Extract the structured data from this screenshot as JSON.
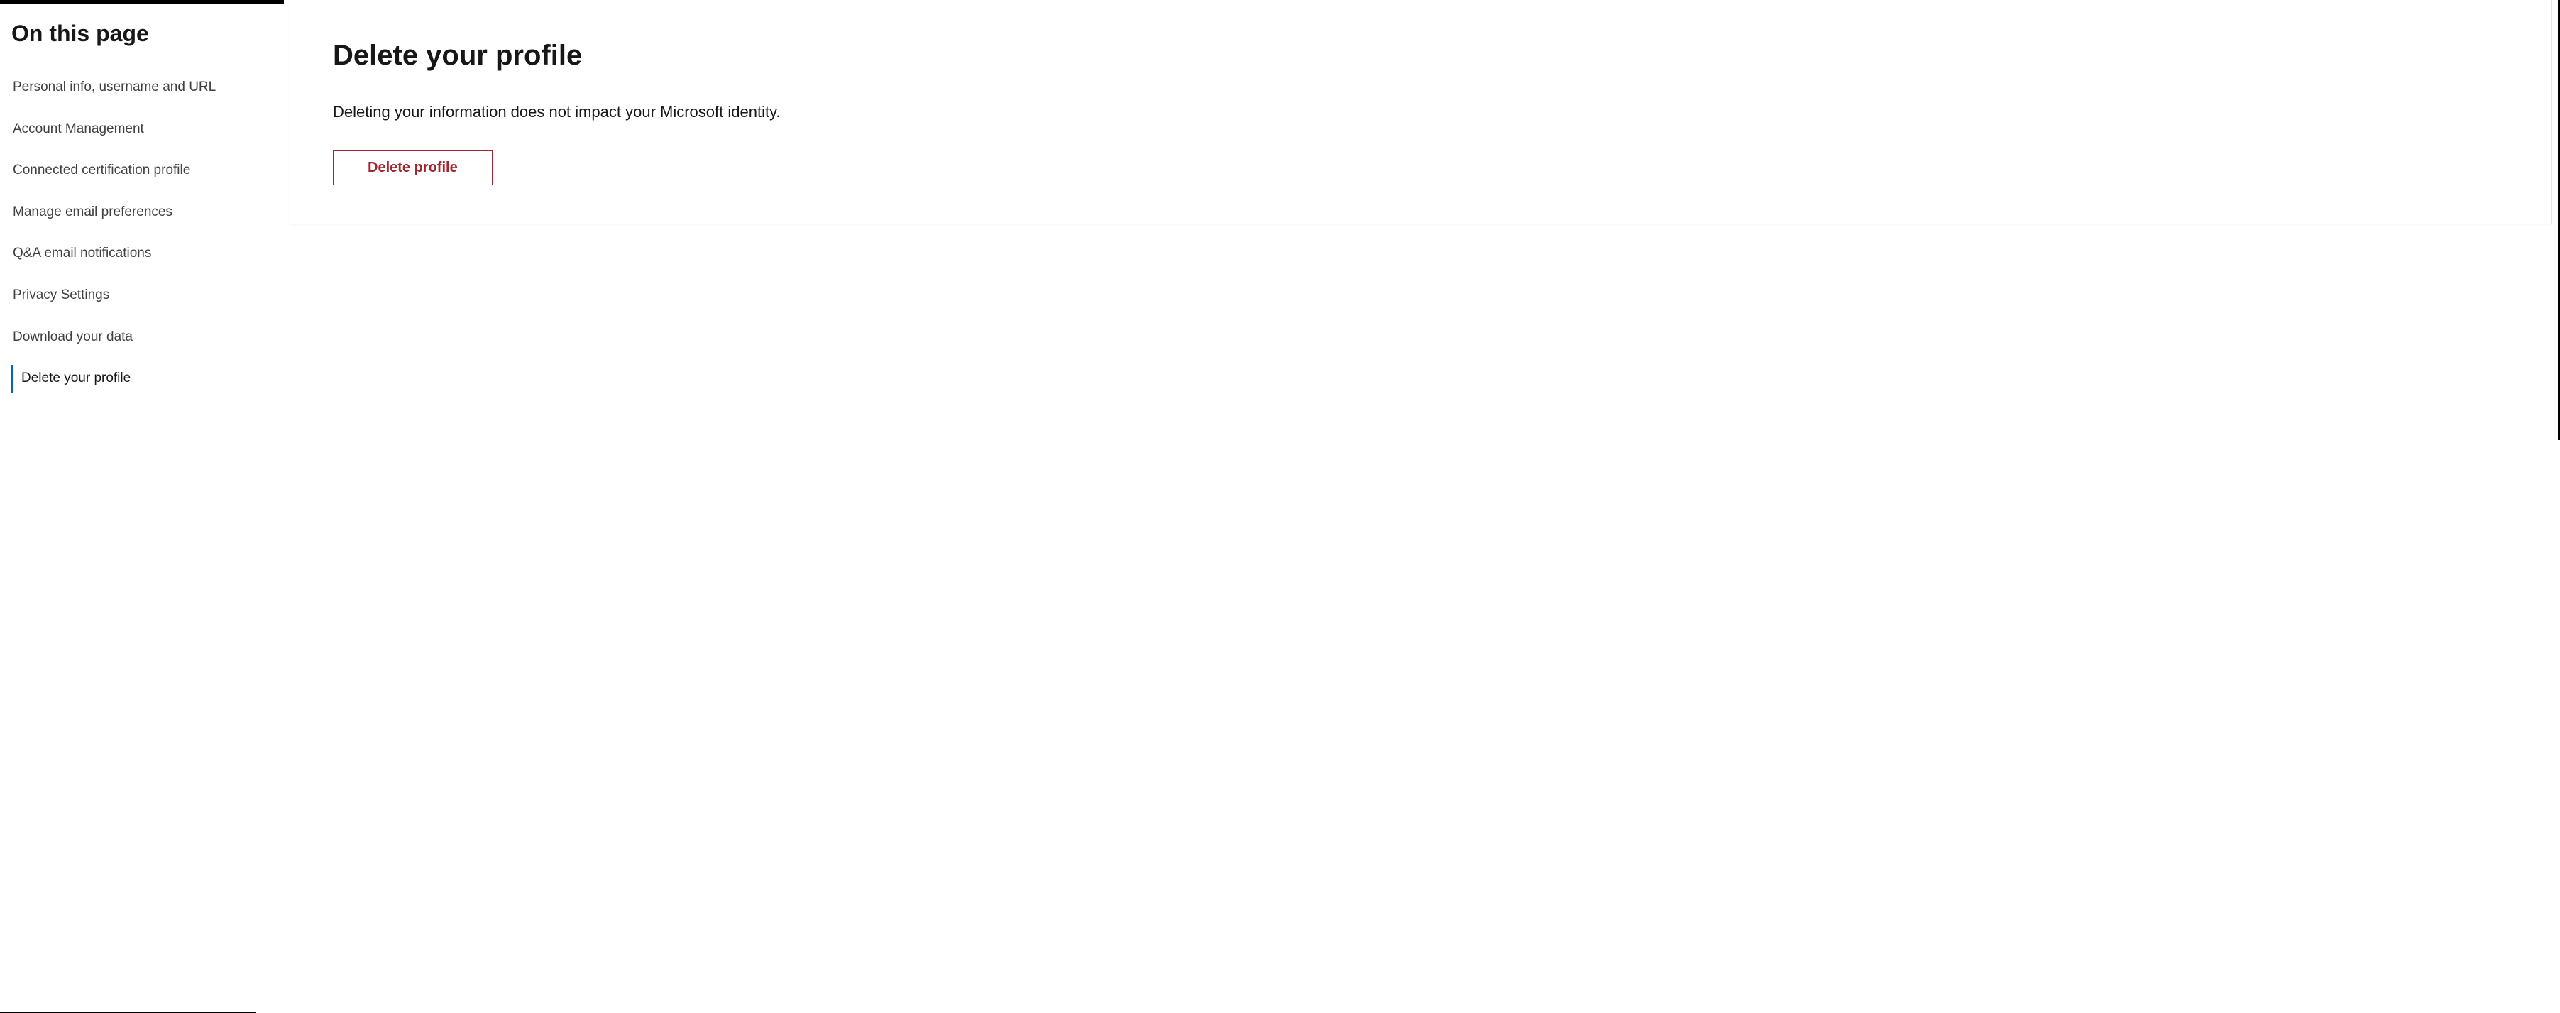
{
  "sidebar": {
    "title": "On this page",
    "items": [
      {
        "label": "Personal info, username and URL",
        "active": false
      },
      {
        "label": "Account Management",
        "active": false
      },
      {
        "label": "Connected certification profile",
        "active": false
      },
      {
        "label": "Manage email preferences",
        "active": false
      },
      {
        "label": "Q&A email notifications",
        "active": false
      },
      {
        "label": "Privacy Settings",
        "active": false
      },
      {
        "label": "Download your data",
        "active": false
      },
      {
        "label": "Delete your profile",
        "active": true
      }
    ]
  },
  "main": {
    "heading": "Delete your profile",
    "description": "Deleting your information does not impact your Microsoft identity.",
    "button_label": "Delete profile"
  }
}
